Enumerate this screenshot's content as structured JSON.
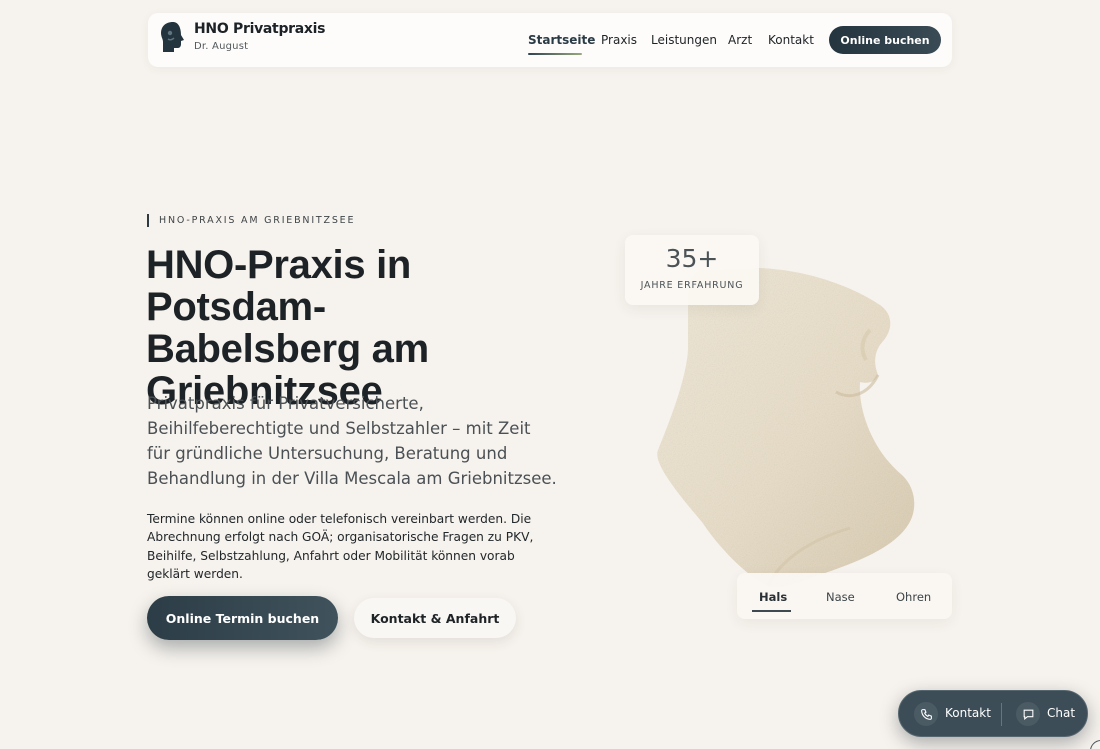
{
  "header": {
    "brand_name": "HNO Privatpraxis",
    "brand_sub": "Dr. August",
    "nav": [
      "Startseite",
      "Praxis",
      "Leistungen",
      "Arzt",
      "Kontakt"
    ],
    "active_nav": "Startseite",
    "cta_label": "Online buchen"
  },
  "hero": {
    "eyebrow": "HNO-PRAXIS AM GRIEBNITZSEE",
    "title_lines": [
      "HNO-Praxis in Potsdam-",
      "Babelsberg am",
      "Griebnitzsee"
    ],
    "lead": "Privatpraxis für Privatversicherte, Beihilfeberechtigte und Selbstzahler – mit Zeit für gründliche Untersuchung, Beratung und Behandlung in der Villa Mescala am Griebnitzsee.",
    "body": "Termine können online oder telefonisch vereinbart werden. Die Abrechnung erfolgt nach GOÄ; organisatorische Fragen zu PKV, Beihilfe, Selbstzahlung, Anfahrt oder Mobilität können vorab geklärt werden.",
    "primary_button": "Online Termin buchen",
    "secondary_button": "Kontakt & Anfahrt"
  },
  "experience": {
    "value": "35+",
    "label": "JAHRE ERFAHRUNG"
  },
  "region_tabs": {
    "items": [
      "Hals",
      "Nase",
      "Ohren"
    ],
    "active": "Hals"
  },
  "floating_bar": {
    "contact_label": "Kontakt",
    "chat_label": "Chat",
    "contact_icon": "phone-icon",
    "chat_icon": "chat-icon"
  },
  "colors": {
    "background": "#f6f2ed",
    "accent_dark": "#2c3d47",
    "text": "#1d2226"
  }
}
